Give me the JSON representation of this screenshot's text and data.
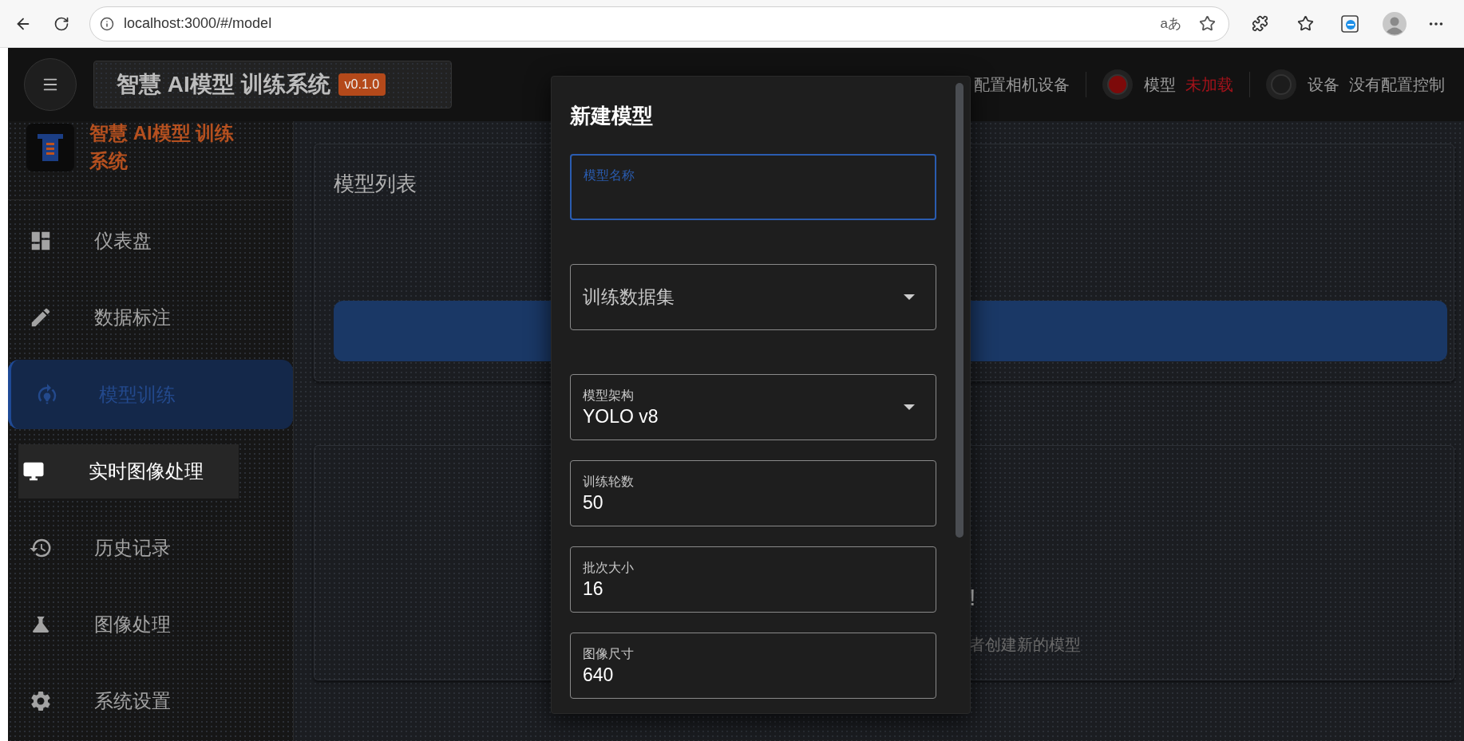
{
  "browser": {
    "url": "localhost:3000/#/model",
    "read_aloud": "aあ"
  },
  "header": {
    "title": "智慧 AI模型 训练系统",
    "version": "v0.1.0",
    "status": [
      {
        "text": "配置相机设备"
      },
      {
        "label": "模型",
        "value": "未加载",
        "alert": true,
        "color": "#7d0a0a"
      },
      {
        "label": "设备",
        "value": "没有配置控制",
        "alert": false,
        "color": "#1c1c1c"
      }
    ]
  },
  "sidebar": {
    "logo_text": "智慧 AI模型 训练系统",
    "items": [
      {
        "label": "仪表盘",
        "selected": false,
        "hovered": false
      },
      {
        "label": "数据标注",
        "selected": false,
        "hovered": false
      },
      {
        "label": "模型训练",
        "selected": true,
        "hovered": false
      },
      {
        "label": "实时图像处理",
        "selected": false,
        "hovered": true
      },
      {
        "label": "历史记录",
        "selected": false,
        "hovered": false
      },
      {
        "label": "图像处理",
        "selected": false,
        "hovered": false
      },
      {
        "label": "系统设置",
        "selected": false,
        "hovered": false
      }
    ]
  },
  "main": {
    "card_title": "模型列表",
    "empty": {
      "title": "!",
      "hint": "者创建新的模型"
    }
  },
  "dialog": {
    "title": "新建模型",
    "fields": [
      {
        "kind": "text",
        "label": "模型名称",
        "focused": true
      },
      {
        "kind": "select",
        "label": "训练数据集",
        "focused": false
      },
      {
        "kind": "select",
        "label": "模型架构",
        "value": "YOLO v8",
        "focused": false
      },
      {
        "kind": "number",
        "label": "训练轮数",
        "value": "50",
        "focused": false
      },
      {
        "kind": "number",
        "label": "批次大小",
        "value": "16",
        "focused": false
      },
      {
        "kind": "number",
        "label": "图像尺寸",
        "value": "640",
        "focused": false
      }
    ]
  }
}
